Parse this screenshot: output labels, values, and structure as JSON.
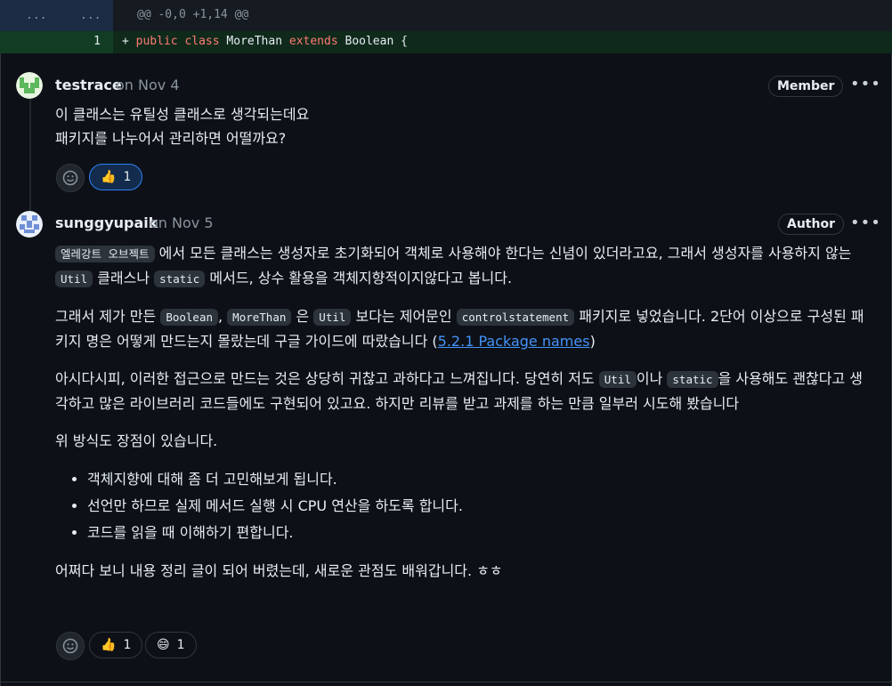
{
  "diff": {
    "gutter_left": "...",
    "gutter_right": "...",
    "hunk_header": "@@ -0,0 +1,14 @@",
    "line_number": "1",
    "code_prefix": "+",
    "code": {
      "kw1": "public",
      "kw2": "class",
      "name": "MoreThan",
      "kw3": "extends",
      "parent": "Boolean",
      "brace": "{"
    }
  },
  "comments": [
    {
      "author": "testrace",
      "when": "on Nov 4",
      "badge": "Member",
      "lines": [
        "이 클래스는 유틸성 클래스로 생각되는데요",
        "패키지를 나누어서 관리하면 어떨까요?"
      ],
      "reactions": [
        {
          "icon": "thumbs-up",
          "count": "1"
        }
      ]
    },
    {
      "author": "sunggyupaik",
      "when": "on Nov 5",
      "badge": "Author",
      "p1": {
        "code1": "엘레강트 오브젝트",
        "t1": " 에서 모든 클래스는 생성자로 초기화되어 객체로 사용해야 한다는 신념이 있더라고요, 그래서 생성자를 사용하지 않는 ",
        "code2": "Util",
        "t2": " 클래스나 ",
        "code3": "static",
        "t3": " 메서드, 상수 활용을 객체지향적이지않다고 봅니다."
      },
      "p2": {
        "t0": "그래서 제가 만든 ",
        "code1": "Boolean",
        "t1": ", ",
        "code2": "MoreThan",
        "t2": " 은 ",
        "code3": "Util",
        "t3": " 보다는 제어문인 ",
        "code4": "controlstatement",
        "t4": " 패키지로 넣었습니다. 2단어 이상으로 구성된 패키지 명은 어떻게 만드는지 몰랐는데 구글 가이드에 따랐습니다 (",
        "link": "5.2.1 Package names",
        "t5": ")"
      },
      "p3": {
        "t0": "아시다시피, 이러한 접근으로 만드는 것은 상당히 귀찮고 과하다고 느껴집니다. 당연히 저도 ",
        "code1": "Util",
        "t1": "이나 ",
        "code2": "static",
        "t2": "을 사용해도 괜찮다고 생각하고 많은 라이브러리 코드들에도 구현되어 있고요. 하지만 리뷰를 받고 과제를 하는 만큼 일부러 시도해 봤습니다"
      },
      "p4": "위 방식도 장점이 있습니다.",
      "bullets": [
        "객체지향에 대해 좀 더 고민해보게 됩니다.",
        "선언만 하므로 실제 메서드 실행 시 CPU 연산을 하도록 합니다.",
        "코드를 읽을 때 이해하기 편합니다."
      ],
      "p5": "어쩌다 보니 내용 정리 글이 되어 버렸는데, 새로운 관점도 배워갑니다. ㅎㅎ",
      "reactions": [
        {
          "icon": "thumbs-up",
          "count": "1"
        },
        {
          "icon": "laugh",
          "count": "1"
        }
      ]
    }
  ],
  "colors": {
    "accent": "#2f81f7",
    "link": "#4493f8",
    "keyword": "#ff7b72"
  }
}
